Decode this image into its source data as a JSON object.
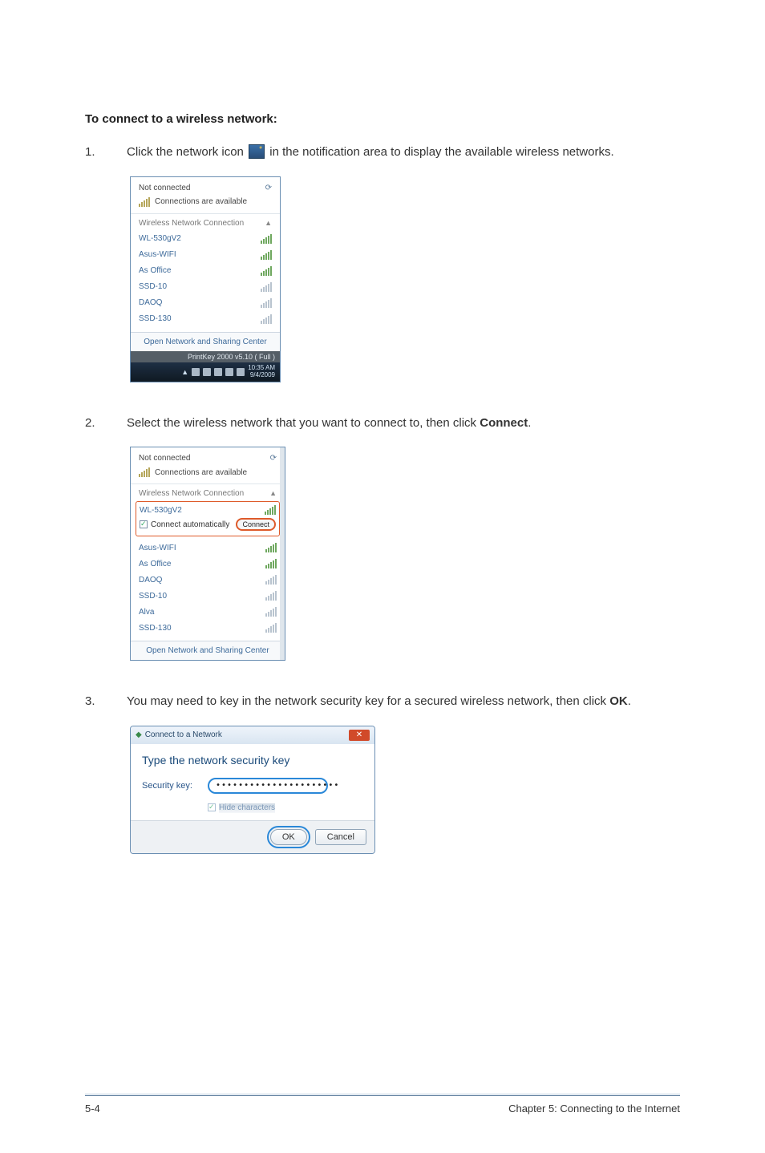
{
  "heading": "To connect to a wireless network:",
  "steps": {
    "s1": {
      "num": "1.",
      "before": "Click the network icon ",
      "after": " in the notification area to display the available wireless networks."
    },
    "s2": {
      "num": "2.",
      "text_before": "Select the wireless network that you want to connect to, then click ",
      "bold": "Connect",
      "text_after": "."
    },
    "s3": {
      "num": "3.",
      "text_before": "You may need to key in the network security key for a secured wireless network, then click ",
      "bold": "OK",
      "text_after": "."
    }
  },
  "popup1": {
    "not_connected": "Not connected",
    "connections_available": "Connections are available",
    "section": "Wireless Network Connection",
    "networks": [
      "WL-530gV2",
      "Asus-WIFI",
      "As Office",
      "SSD-10",
      "DAOQ",
      "SSD-130"
    ],
    "footer_link": "Open Network and Sharing Center",
    "tooltip": "PrintKey 2000  v5.10 ( Full )",
    "time": "10:35 AM",
    "date": "9/4/2009"
  },
  "popup2": {
    "not_connected": "Not connected",
    "connections_available": "Connections are available",
    "section": "Wireless Network Connection",
    "selected": "WL-530gV2",
    "auto_label": "Connect automatically",
    "connect_btn": "Connect",
    "networks": [
      "Asus-WIFI",
      "As Office",
      "DAOQ",
      "SSD-10",
      "Alva",
      "SSD-130"
    ],
    "footer_link": "Open Network and Sharing Center"
  },
  "dialog": {
    "title": "Connect to a Network",
    "heading": "Type the network security key",
    "label": "Security key:",
    "value": "••••••••••••••••••••••",
    "hide": "Hide characters",
    "ok": "OK",
    "cancel": "Cancel"
  },
  "footer": {
    "left": "5-4",
    "right": "Chapter 5: Connecting to the Internet"
  }
}
